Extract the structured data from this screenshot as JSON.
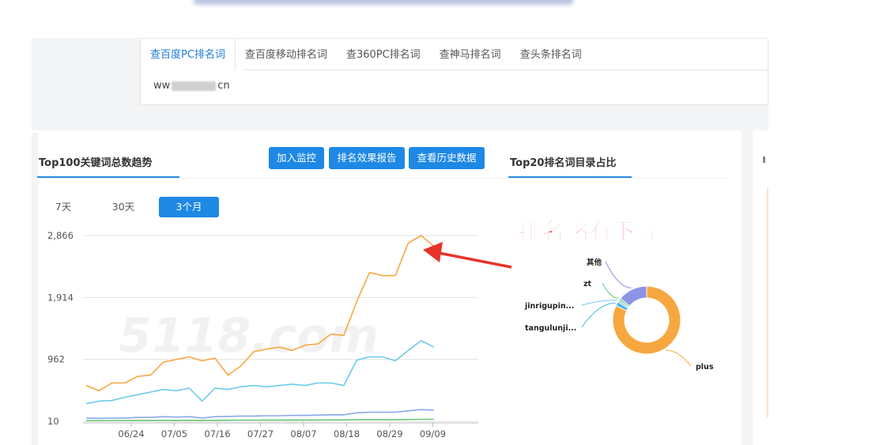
{
  "tabs": [
    "查百度PC排名词",
    "查百度移动排名词",
    "查360PC排名词",
    "查神马排名词",
    "查头条排名词"
  ],
  "domain": {
    "prefix": "ww",
    "suffix": "cn"
  },
  "trend": {
    "title": "Top100关键词总数趋势"
  },
  "actions": [
    "加入监控",
    "排名效果报告",
    "查看历史数据"
  ],
  "pie": {
    "title": "Top20排名词目录占比"
  },
  "ranges": [
    "7天",
    "30天",
    "3个月"
  ],
  "annotation": "排名略有下降",
  "watermark": "5118.com",
  "colors": {
    "accent": "#1e88e5",
    "orange": "#f7a740",
    "cyan": "#6ccaeb",
    "blue": "#8aa7ea",
    "green": "#6ac97a",
    "purple": "#8d93e6"
  },
  "chart_data": [
    {
      "type": "line",
      "title": "",
      "yticks": [
        "2,866",
        "1,914",
        "962",
        "10"
      ],
      "xticks": [
        "06/24",
        "07/05",
        "07/16",
        "07/27",
        "08/07",
        "08/18",
        "08/29",
        "09/09"
      ],
      "ylim": [
        10,
        2866
      ],
      "series": [
        {
          "color": "#f7a740",
          "values": [
            560,
            480,
            600,
            600,
            700,
            720,
            920,
            960,
            1000,
            940,
            980,
            720,
            860,
            1080,
            1120,
            1150,
            1100,
            1180,
            1200,
            1350,
            1330,
            1850,
            2300,
            2250,
            2250,
            2750,
            2866,
            2700
          ]
        },
        {
          "color": "#6ccaeb",
          "values": [
            280,
            320,
            330,
            380,
            420,
            460,
            500,
            480,
            520,
            320,
            520,
            500,
            540,
            560,
            540,
            560,
            580,
            560,
            600,
            600,
            560,
            950,
            1000,
            1000,
            940,
            1100,
            1250,
            1150
          ]
        },
        {
          "color": "#8aa7ea",
          "values": [
            60,
            55,
            60,
            60,
            70,
            70,
            80,
            75,
            80,
            60,
            80,
            85,
            90,
            90,
            95,
            95,
            100,
            100,
            105,
            110,
            110,
            140,
            150,
            150,
            150,
            170,
            190,
            180
          ]
        },
        {
          "color": "#6ac97a",
          "values": [
            20,
            20,
            22,
            22,
            24,
            25,
            25,
            25,
            26,
            25,
            26,
            27,
            28,
            28,
            30,
            30,
            30,
            30,
            31,
            32,
            32,
            35,
            36,
            36,
            36,
            38,
            40,
            40
          ]
        }
      ]
    },
    {
      "type": "pie",
      "title": "",
      "labels": [
        "plus",
        "tangulunji...",
        "jinrigupin...",
        "zt",
        "其他"
      ],
      "values": [
        82,
        2,
        1,
        1,
        14
      ],
      "colors": [
        "#f7a740",
        "#4ab6e0",
        "#7cc6e8",
        "#6ac97a",
        "#8d93e6"
      ]
    }
  ]
}
